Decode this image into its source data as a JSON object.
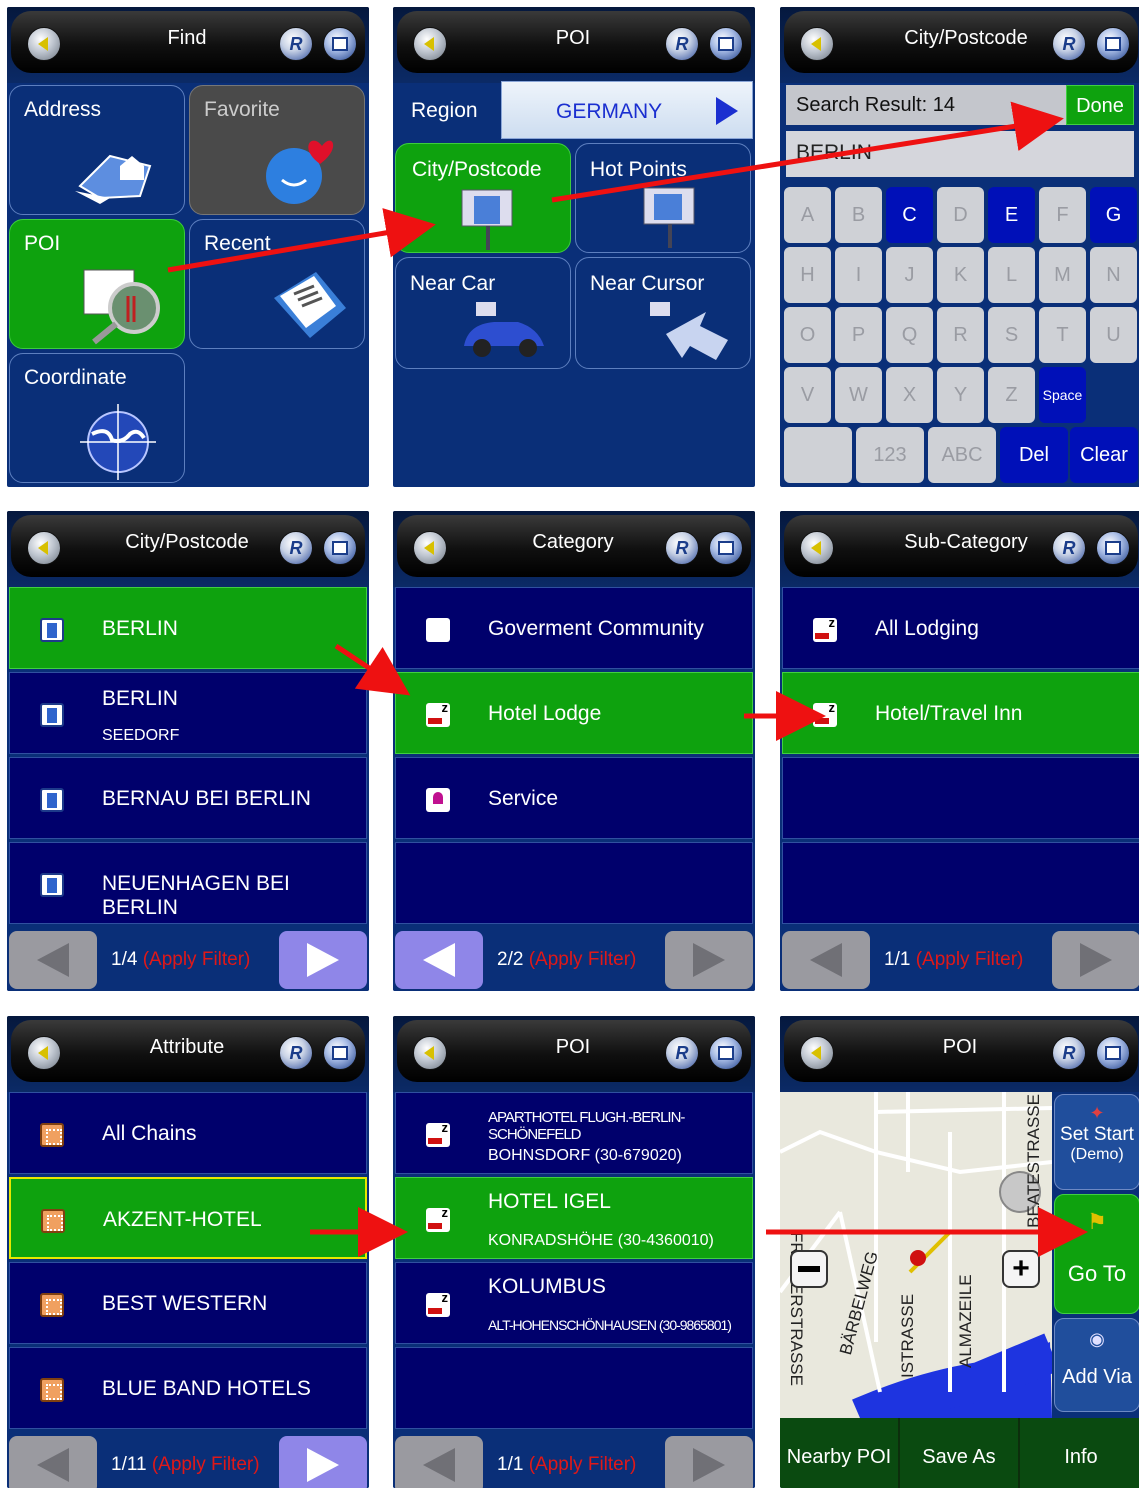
{
  "p1": {
    "title": "Find",
    "tiles": [
      "Address",
      "Favorite",
      "POI",
      "Recent",
      "Coordinate"
    ]
  },
  "p2": {
    "title": "POI",
    "region_label": "Region",
    "region_value": "GERMANY",
    "tiles": [
      "City/Postcode",
      "Hot Points",
      "Near Car",
      "Near Cursor"
    ]
  },
  "p3": {
    "title": "City/Postcode",
    "search_result": "Search Result: 14",
    "done": "Done",
    "input": "BERLIN",
    "rows": [
      [
        "A",
        "B",
        "C",
        "D",
        "E",
        "F",
        "G"
      ],
      [
        "H",
        "I",
        "J",
        "K",
        "L",
        "M",
        "N"
      ],
      [
        "O",
        "P",
        "Q",
        "R",
        "S",
        "T",
        "U"
      ],
      [
        "V",
        "W",
        "X",
        "Y",
        "Z",
        "Space"
      ]
    ],
    "bottom": [
      "123",
      "ABC",
      "Del",
      "Clear"
    ]
  },
  "p4": {
    "title": "City/Postcode",
    "items": [
      {
        "name": "BERLIN",
        "sub": ""
      },
      {
        "name": "BERLIN",
        "sub": "SEEDORF"
      },
      {
        "name": "BERNAU BEI BERLIN",
        "sub": ""
      },
      {
        "name": "NEUENHAGEN BEI BERLIN",
        "sub": ""
      }
    ],
    "page": "1/4",
    "filter": "(Apply Filter)"
  },
  "p5": {
    "title": "Category",
    "items": [
      "Goverment Community",
      "Hotel Lodge",
      "Service"
    ],
    "page": "2/2",
    "filter": "(Apply Filter)"
  },
  "p6": {
    "title": "Sub-Category",
    "items": [
      "All Lodging",
      "Hotel/Travel Inn"
    ],
    "page": "1/1",
    "filter": "(Apply Filter)"
  },
  "p7": {
    "title": "Attribute",
    "items": [
      "All Chains",
      "AKZENT-HOTEL",
      "BEST WESTERN",
      "BLUE BAND HOTELS"
    ],
    "page": "1/11",
    "filter": "(Apply Filter)"
  },
  "p8": {
    "title": "POI",
    "items": [
      {
        "name": "APARTHOTEL FLUGH.-BERLIN-SCHÖNEFELD",
        "sub": "BOHNSDORF (30-679020)"
      },
      {
        "name": "HOTEL IGEL",
        "sub": "KONRADSHÖHE (30-4360010)"
      },
      {
        "name": "KOLUMBUS",
        "sub": "ALT-HOHENSCHÖNHAUSEN (30-9865801)"
      }
    ],
    "page": "1/1",
    "filter": "(Apply Filter)"
  },
  "p9": {
    "title": "POI",
    "streets": [
      "FRIEDERSTRASSE",
      "BEATESTRASSE",
      "BÄRBELWEG",
      "ALMAZEILE",
      "ISTRASSE"
    ],
    "side": {
      "set_start": "Set Start",
      "demo": "(Demo)",
      "go_to": "Go To",
      "add_via": "Add Via"
    },
    "bottom": [
      "Nearby POI",
      "Save As",
      "Info"
    ]
  },
  "colors": {
    "panel_bg": "#0a2f78",
    "green": "#0ea20e",
    "arrow": "#ee1111"
  }
}
